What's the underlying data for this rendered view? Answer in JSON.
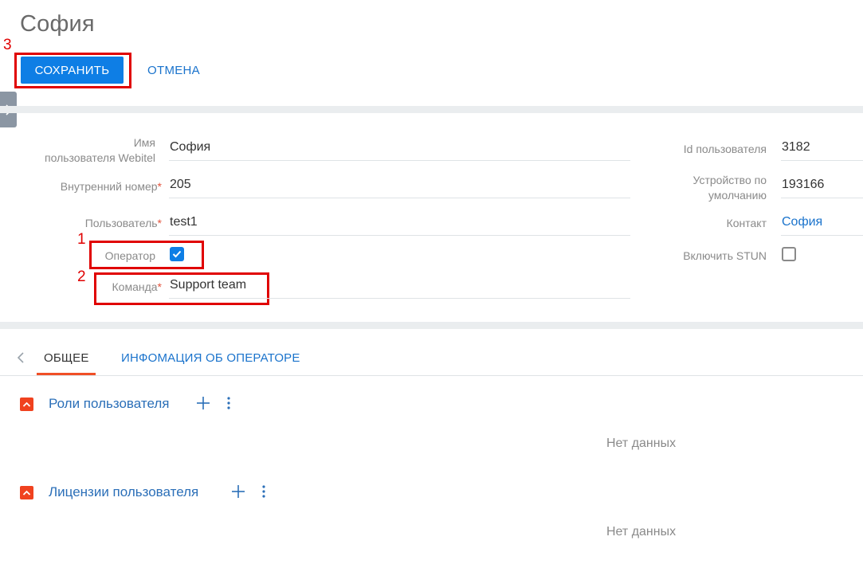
{
  "header": {
    "title": "София",
    "save_label": "СОХРАНИТЬ",
    "cancel_label": "ОТМЕНА"
  },
  "annotations": [
    "1",
    "2",
    "3"
  ],
  "fields_left": {
    "webitel_user": {
      "label_line1": "Имя",
      "label_line2": "пользователя Webitel",
      "value": "София"
    },
    "internal_number": {
      "label": "Внутренний номер",
      "value": "205"
    },
    "user": {
      "label": "Пользователь",
      "value": "test1"
    },
    "operator": {
      "label": "Оператор",
      "checked": true
    },
    "team": {
      "label": "Команда",
      "value": "Support team"
    }
  },
  "fields_right": {
    "user_id": {
      "label": "Id пользователя",
      "value": "3182"
    },
    "default_device": {
      "label_line1": "Устройство по",
      "label_line2": "умолчанию",
      "value": "193166"
    },
    "contact": {
      "label": "Контакт",
      "value": "София"
    },
    "enable_stun": {
      "label": "Включить STUN",
      "checked": false
    }
  },
  "required_mark": "*",
  "tabs": [
    {
      "label": "ОБЩЕЕ",
      "active": true
    },
    {
      "label": "ИНФОМАЦИЯ ОБ ОПЕРАТОРЕ",
      "active": false
    }
  ],
  "sections": [
    {
      "title": "Роли пользователя",
      "empty_text": "Нет данных"
    },
    {
      "title": "Лицензии пользователя",
      "empty_text": "Нет данных"
    }
  ],
  "colors": {
    "primary": "#0e7ee5",
    "link": "#1a73cc",
    "accent": "#f0421f",
    "annotation": "#e00000"
  },
  "icons": [
    "chevron-right-icon",
    "checkmark-icon",
    "chevron-left-icon",
    "collapse-up-icon",
    "plus-icon",
    "more-vertical-icon"
  ]
}
